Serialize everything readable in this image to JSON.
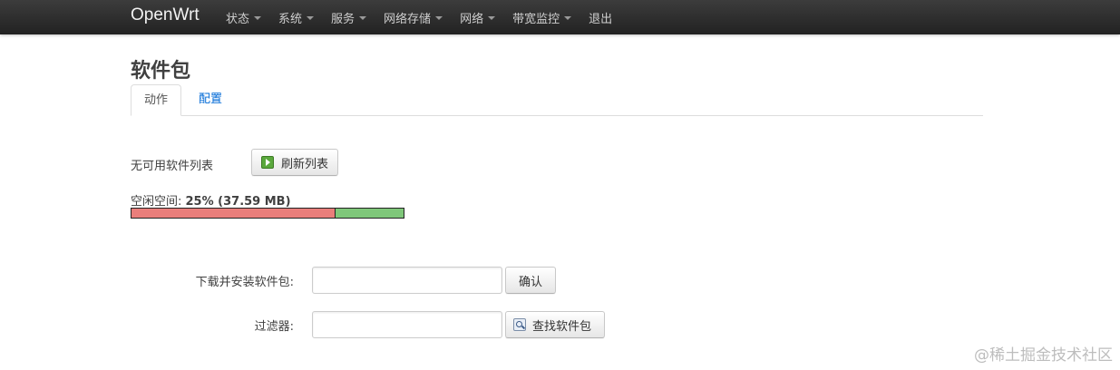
{
  "navbar": {
    "brand": "OpenWrt",
    "items": [
      {
        "label": "状态",
        "dropdown": true
      },
      {
        "label": "系统",
        "dropdown": true
      },
      {
        "label": "服务",
        "dropdown": true
      },
      {
        "label": "网络存储",
        "dropdown": true
      },
      {
        "label": "网络",
        "dropdown": true
      },
      {
        "label": "带宽监控",
        "dropdown": true
      },
      {
        "label": "退出",
        "dropdown": false
      }
    ]
  },
  "page": {
    "title": "软件包"
  },
  "tabs": [
    {
      "label": "动作",
      "active": true
    },
    {
      "label": "配置",
      "active": false
    }
  ],
  "actions": {
    "no_list_text": "无可用软件列表",
    "refresh_button": "刷新列表",
    "free_space_label": "空闲空间: ",
    "free_space_value": "25% (37.59 MB)",
    "used_fraction": 0.75,
    "colors": {
      "used": "#e97e7b",
      "free": "#7fc77a"
    }
  },
  "form": {
    "download_label": "下载并安装软件包:",
    "download_value": "",
    "confirm_button": "确认",
    "filter_label": "过滤器:",
    "filter_value": "",
    "find_button": "查找软件包"
  },
  "watermark": "@稀土掘金技术社区"
}
